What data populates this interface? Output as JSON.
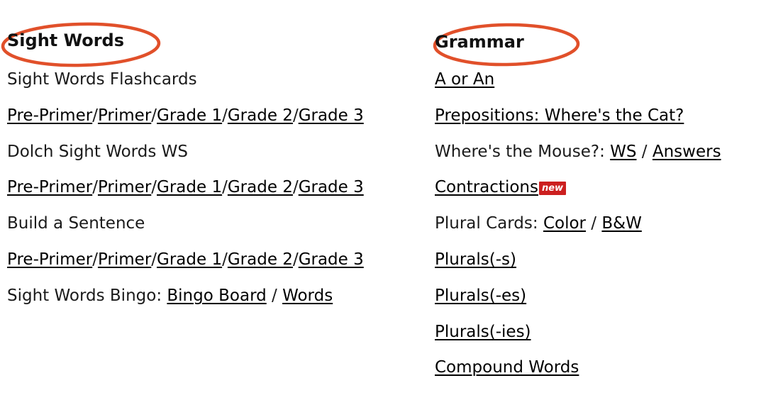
{
  "page": {
    "background": "#ffffff",
    "text_color": "#1a1a1a",
    "highlight_color": "#e1502a",
    "badge_color": "#cc1f1f"
  },
  "columns": [
    {
      "id": "sight-words",
      "heading": "Sight Words",
      "rows": [
        {
          "id": "sight-words-flashcards",
          "segments": [
            {
              "text": "Sight Words Flashcards",
              "link": false
            }
          ]
        },
        {
          "id": "flashcards-levels",
          "segments": [
            {
              "text": "Pre-Primer",
              "link": true
            },
            {
              "text": "/",
              "link": false
            },
            {
              "text": "Primer",
              "link": true
            },
            {
              "text": "/",
              "link": false
            },
            {
              "text": "Grade 1",
              "link": true
            },
            {
              "text": "/",
              "link": false
            },
            {
              "text": "Grade 2",
              "link": true
            },
            {
              "text": "/",
              "link": false
            },
            {
              "text": "Grade 3",
              "link": true
            }
          ]
        },
        {
          "id": "dolch-sight-words-ws",
          "segments": [
            {
              "text": "Dolch Sight Words WS",
              "link": false
            }
          ]
        },
        {
          "id": "dolch-levels",
          "segments": [
            {
              "text": "Pre-Primer",
              "link": true
            },
            {
              "text": "/",
              "link": false
            },
            {
              "text": "Primer",
              "link": true
            },
            {
              "text": "/",
              "link": false
            },
            {
              "text": "Grade 1",
              "link": true
            },
            {
              "text": "/",
              "link": false
            },
            {
              "text": "Grade 2",
              "link": true
            },
            {
              "text": "/",
              "link": false
            },
            {
              "text": "Grade 3",
              "link": true
            }
          ]
        },
        {
          "id": "build-a-sentence",
          "segments": [
            {
              "text": "Build a Sentence",
              "link": false
            }
          ]
        },
        {
          "id": "build-a-sentence-levels",
          "segments": [
            {
              "text": "Pre-Primer",
              "link": true
            },
            {
              "text": "/",
              "link": false
            },
            {
              "text": "Primer",
              "link": true
            },
            {
              "text": "/",
              "link": false
            },
            {
              "text": "Grade 1",
              "link": true
            },
            {
              "text": "/",
              "link": false
            },
            {
              "text": "Grade 2",
              "link": true
            },
            {
              "text": "/",
              "link": false
            },
            {
              "text": "Grade 3",
              "link": true
            }
          ]
        },
        {
          "id": "sight-words-bingo",
          "segments": [
            {
              "text": "Sight Words Bingo: ",
              "link": false
            },
            {
              "text": "Bingo Board",
              "link": true
            },
            {
              "text": " / ",
              "link": false
            },
            {
              "text": "Words",
              "link": true
            }
          ]
        }
      ]
    },
    {
      "id": "grammar",
      "heading": "Grammar",
      "rows": [
        {
          "id": "a-or-an",
          "segments": [
            {
              "text": "A or An",
              "link": true
            }
          ]
        },
        {
          "id": "prepositions-wheres-the-cat",
          "segments": [
            {
              "text": "Prepositions: Where's the Cat?",
              "link": true
            }
          ]
        },
        {
          "id": "wheres-the-mouse",
          "segments": [
            {
              "text": "Where's the Mouse?: ",
              "link": false
            },
            {
              "text": "WS",
              "link": true
            },
            {
              "text": " / ",
              "link": false
            },
            {
              "text": "Answers",
              "link": true
            }
          ]
        },
        {
          "id": "contractions",
          "segments": [
            {
              "text": "Contractions",
              "link": true
            }
          ],
          "badge": "new"
        },
        {
          "id": "plural-cards",
          "segments": [
            {
              "text": "Plural Cards: ",
              "link": false
            },
            {
              "text": "Color",
              "link": true
            },
            {
              "text": " / ",
              "link": false
            },
            {
              "text": "B&W",
              "link": true
            }
          ]
        },
        {
          "id": "plurals-s",
          "segments": [
            {
              "text": "Plurals(-s)",
              "link": true
            }
          ]
        },
        {
          "id": "plurals-es",
          "segments": [
            {
              "text": "Plurals(-es)",
              "link": true
            }
          ]
        },
        {
          "id": "plurals-ies",
          "segments": [
            {
              "text": "Plurals(-ies)",
              "link": true
            }
          ]
        },
        {
          "id": "compound-words",
          "segments": [
            {
              "text": "Compound Words",
              "link": true
            }
          ]
        }
      ]
    }
  ],
  "layout": {
    "row_top_start": 100,
    "row_step": 50.8
  }
}
